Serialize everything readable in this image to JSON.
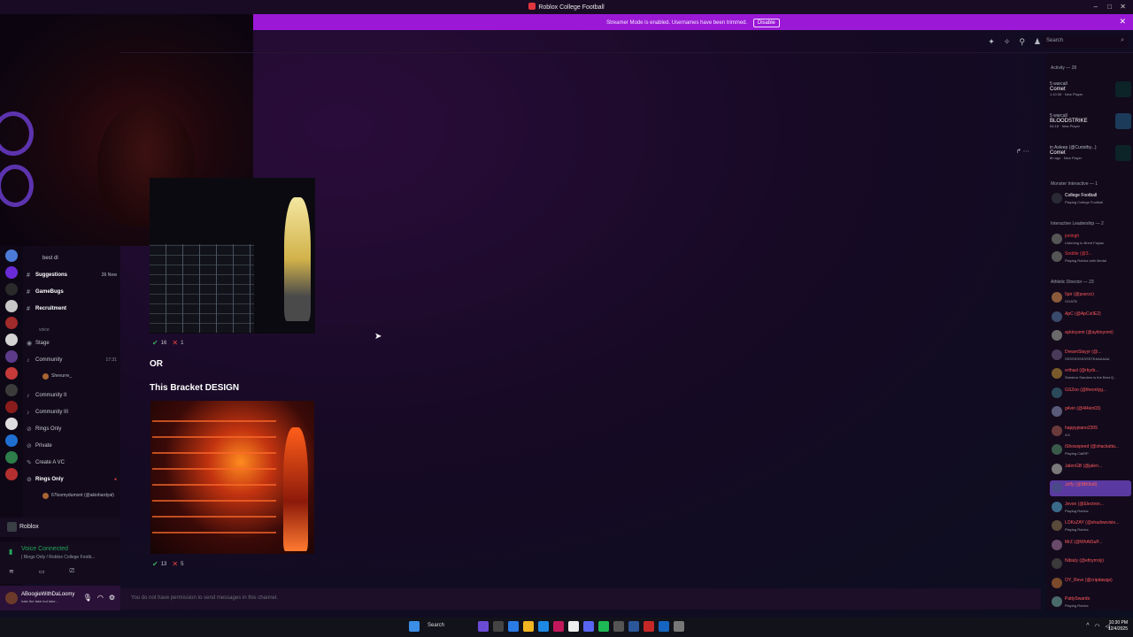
{
  "titlebar": {
    "title": "Roblox College Football",
    "min": "–",
    "max": "□",
    "close": "✕"
  },
  "banner": {
    "text": "Streamer Mode is enabled. Usernames have been trimmed.",
    "button": "Disable",
    "close": "✕"
  },
  "header": {
    "search_placeholder": "Search"
  },
  "channels": {
    "items": [
      {
        "label": "best dl",
        "meta": ""
      },
      {
        "label": "Suggestions",
        "meta": "26 New"
      },
      {
        "label": "GameBugs",
        "meta": ""
      },
      {
        "label": "Recruitment",
        "meta": ""
      }
    ],
    "voice_category": "voice",
    "voice": [
      {
        "label": "Stage",
        "meta": ""
      },
      {
        "label": "Community",
        "meta": "17:31"
      },
      {
        "label": "Community II",
        "meta": ""
      },
      {
        "label": "Community III",
        "meta": ""
      },
      {
        "label": "Rings Only",
        "meta": ""
      },
      {
        "label": "Private",
        "meta": ""
      },
      {
        "label": "Create A VC",
        "meta": ""
      },
      {
        "label": "Rings Only",
        "meta": "●"
      }
    ],
    "voice_users": [
      "Shevurre_",
      "67loomydumont (@akiohardyal)"
    ]
  },
  "roblox_activity": "Roblox",
  "voice_connected": {
    "title": "Voice Connected",
    "subtitle": "| Rings Only / Roblox College Footb..."
  },
  "user": {
    "name": "ABoogieWithDaLoomy",
    "status": "hate the fake but take..."
  },
  "messages": {
    "reacts1": {
      "check": "16",
      "x": "1"
    },
    "or_text": "OR",
    "design_text": "This Bracket DESIGN",
    "reacts2": {
      "check": "13",
      "x": "5"
    }
  },
  "composer": {
    "placeholder": "You do not have permission to send messages in this channel."
  },
  "members": {
    "activity_header": "Activity — 28",
    "activities": [
      {
        "l1": "5 warcall",
        "l2": "Comet",
        "l3": "1:10:36 · New Player"
      },
      {
        "l1": "5 warcall",
        "l2": "BLOODSTRIKE",
        "l3": "54:18 · New Player"
      },
      {
        "l1": "in Asleep (@Curiothy...)",
        "l2": "Comet",
        "l3": "8h ago · New Player"
      }
    ],
    "monster_header": "Monster Interactive — 1",
    "monster_member": {
      "name": "College Football",
      "status": "Playing College Football"
    },
    "leadership_header": "Interactive Leadership — 2",
    "leadership": [
      {
        "name": "joningh",
        "status": "Listening to Brent Faiyaz"
      },
      {
        "name": "Soddie (@3...",
        "status": "Playing Roblox with Medal"
      }
    ],
    "athletic_header": "Athletic Director — 23",
    "athletic": [
      {
        "name": "5pir (@pserzc)",
        "status": "GOATB"
      },
      {
        "name": "ApC (@ApCxIIE2)",
        "status": ""
      },
      {
        "name": "ayktoyomi (@ayktoyomi)",
        "status": ""
      },
      {
        "name": "DreamSlayyr (@...",
        "status": "SSSSSSSSSSSTEAAAAAA"
      },
      {
        "name": "erthaxl (@rkyrb...",
        "status": "Shedeur Sanders is the Best Q..."
      },
      {
        "name": "GSZoo (@theonlyg...",
        "status": ""
      },
      {
        "name": "g4vin (@4l4vin03)",
        "status": ""
      },
      {
        "name": "happypiano2305",
        "status": "4:5"
      },
      {
        "name": "iShowspeed (@shackatta...",
        "status": "Playing CallRP"
      },
      {
        "name": "JalenGB (@jalen...",
        "status": ""
      },
      {
        "name": "Jeffy (@BBtIla8)",
        "status": ""
      },
      {
        "name": "Jevon (@Electron...",
        "status": "Playing Roblox"
      },
      {
        "name": "LOKsZAY (@shadowvisio...",
        "status": "Playing Roblox"
      },
      {
        "name": "MrZ (@WhAtSuP...",
        "status": ""
      },
      {
        "name": "Nibiuly (@ethyrroly)",
        "status": ""
      },
      {
        "name": "OY_Revv (@cripdawgs)",
        "status": ""
      },
      {
        "name": "PattySwardo",
        "status": "Playing Roblox"
      }
    ]
  },
  "taskbar": {
    "search": "Search",
    "time": "10:30 PM",
    "date": "12/4/2025"
  },
  "colors": {
    "banner": "#9b19d6",
    "accent": "#5865f2",
    "danger": "#ed4245",
    "online": "#23a55a"
  }
}
